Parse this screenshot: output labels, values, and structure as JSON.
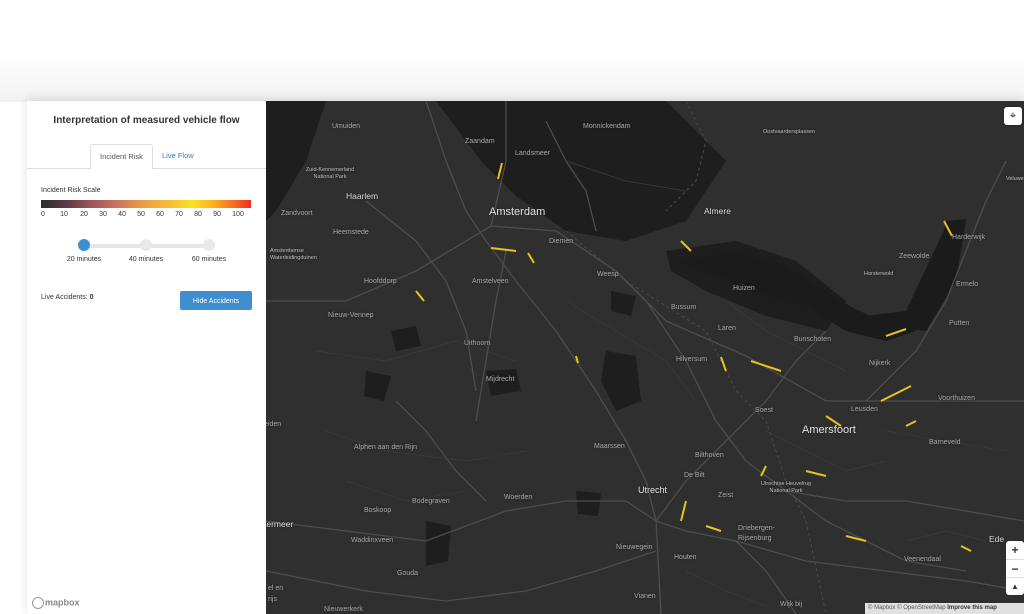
{
  "panel": {
    "title": "Interpretation of measured vehicle flow",
    "tabs": [
      {
        "label": "Incident Risk",
        "active": true
      },
      {
        "label": "Live Flow",
        "active": false
      }
    ],
    "scale": {
      "label": "Incident Risk Scale",
      "ticks": [
        "0",
        "10",
        "20",
        "30",
        "40",
        "50",
        "60",
        "70",
        "80",
        "90",
        "100"
      ],
      "colors": [
        "#2b2b2b",
        "#a1585c",
        "#f0a040",
        "#fde021",
        "#ef2a1c"
      ]
    },
    "slider": {
      "options": [
        "20 minutes",
        "40 minutes",
        "60 minutes"
      ],
      "selected_index": 0
    },
    "live_accidents": {
      "label": "Live Accidents:",
      "count": "0"
    },
    "hide_button": "Hide Accidents",
    "mapbox_logo": "mapbox"
  },
  "map": {
    "background": "#2f2f2f",
    "water": "#1e1e1e",
    "road_highlight": "#e6c31b",
    "places_large": [
      "Amsterdam",
      "Amersfoort",
      "Utrecht"
    ],
    "places_medium": [
      "Haarlem",
      "Almere"
    ],
    "places": [
      "Umuiden",
      "Zaandam",
      "Landsmeer",
      "Monnickendam",
      "Oostvaardersplassen",
      "Zandvoort",
      "Heemstede",
      "Diemen",
      "Harderwijk",
      "Zeewolde",
      "Horsterwold",
      "Ermelo",
      "Weesp",
      "Huizen",
      "Hoofddorp",
      "Amstelveen",
      "Bussum",
      "Nieuw-Vennep",
      "Uithoorn",
      "Laren",
      "Bunschoten",
      "Putten",
      "Hilversum",
      "Nijkerk",
      "Mijdrecht",
      "Soest",
      "Leusden",
      "Voorthuizen",
      "eiden",
      "Alphen aan den Rijn",
      "Maarssen",
      "Bilthoven",
      "Barneveld",
      "De Bilt",
      "Zeist",
      "Bodegraven",
      "Woerden",
      "Boskoop",
      "termeer",
      "Waddinxveen",
      "Driebergen-Rijsenburg",
      "Nieuwegein",
      "Houten",
      "Gouda",
      "Veenendaal",
      "Ede",
      "Vianen",
      "Wijk bij",
      "Nieuwerkerk",
      "el en",
      "rijs",
      "Veluwe"
    ],
    "places_small": [
      "Zuid-Kennemerland National Park",
      "Amsterdamse Waterleidingduinen",
      "Utrechtse Heuvelrug National Park"
    ],
    "controls": {
      "geolocate": "geolocate",
      "zoom_in": "+",
      "zoom_out": "−",
      "compass": "▲"
    },
    "attribution": {
      "prefix": "© Mapbox © OpenStreetMap",
      "improve": "Improve this map"
    }
  }
}
